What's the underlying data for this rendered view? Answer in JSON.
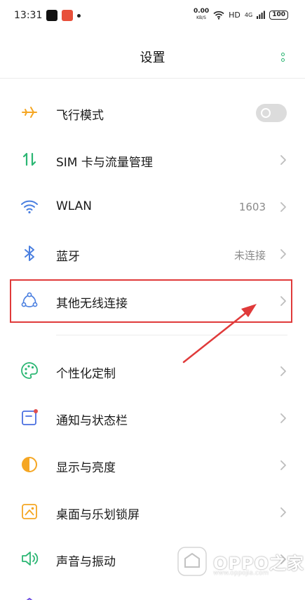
{
  "status_bar": {
    "time": "13:31",
    "net_speed": "0.00",
    "net_unit": "KB/S",
    "hd": "HD",
    "signal": "4G",
    "battery": "100"
  },
  "header": {
    "title": "设置"
  },
  "settings": [
    {
      "label": "飞行模式",
      "icon": "airplane-icon",
      "control": "toggle",
      "value": ""
    },
    {
      "label": "SIM 卡与流量管理",
      "icon": "data-transfer-icon",
      "control": "chevron",
      "value": ""
    },
    {
      "label": "WLAN",
      "icon": "wifi-icon",
      "control": "chevron",
      "value": "1603"
    },
    {
      "label": "蓝牙",
      "icon": "bluetooth-icon",
      "control": "chevron",
      "value": "未连接"
    },
    {
      "label": "其他无线连接",
      "icon": "wireless-connections-icon",
      "control": "chevron",
      "value": ""
    },
    {
      "label": "个性化定制",
      "icon": "palette-icon",
      "control": "chevron",
      "value": ""
    },
    {
      "label": "通知与状态栏",
      "icon": "notification-icon",
      "control": "chevron",
      "value": ""
    },
    {
      "label": "显示与亮度",
      "icon": "brightness-icon",
      "control": "chevron",
      "value": ""
    },
    {
      "label": "桌面与乐划锁屏",
      "icon": "wallpaper-icon",
      "control": "chevron",
      "value": ""
    },
    {
      "label": "声音与振动",
      "icon": "sound-icon",
      "control": "chevron",
      "value": ""
    }
  ],
  "airplane_mode": false,
  "watermark": {
    "brand": "OPPO之家",
    "url": "www.oppojia.com"
  },
  "colors": {
    "accent": "#2bb673",
    "highlight": "#e03a3a"
  }
}
